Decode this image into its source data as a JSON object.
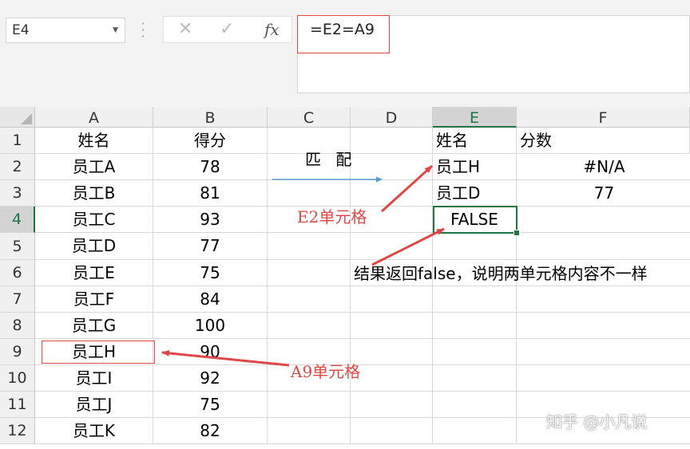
{
  "namebox": {
    "value": "E4"
  },
  "formula_bar": {
    "cancel_icon": "✕",
    "confirm_icon": "✓",
    "fx_label": "fx",
    "formula": "=E2=A9"
  },
  "columns": [
    "A",
    "B",
    "C",
    "D",
    "E",
    "F"
  ],
  "rows": [
    "1",
    "2",
    "3",
    "4",
    "5",
    "6",
    "7",
    "8",
    "9",
    "10",
    "11",
    "12"
  ],
  "cells": {
    "A": [
      "姓名",
      "员工A",
      "员工B",
      "员工C",
      "员工D",
      "员工E",
      "员工F",
      "员工G",
      "员工H",
      "员工I",
      "员工J",
      "员工K"
    ],
    "B": [
      "得分",
      "78",
      "81",
      "93",
      "77",
      "75",
      "84",
      "100",
      "90",
      "92",
      "75",
      "82"
    ],
    "E": [
      "姓名",
      "员工H",
      "员工D",
      "FALSE"
    ],
    "F": [
      "分数",
      "#N/A",
      "77"
    ]
  },
  "annotations": {
    "match_label": "匹 配",
    "e2_label": "E2单元格",
    "a9_label": "A9单元格",
    "note": "结果返回false，说明两单元格内容不一样"
  },
  "watermark": "知乎 @小凡说",
  "colors": {
    "accent_green": "#217346",
    "annotation_red": "#e04848",
    "arrow_blue": "#5b9bd5"
  }
}
